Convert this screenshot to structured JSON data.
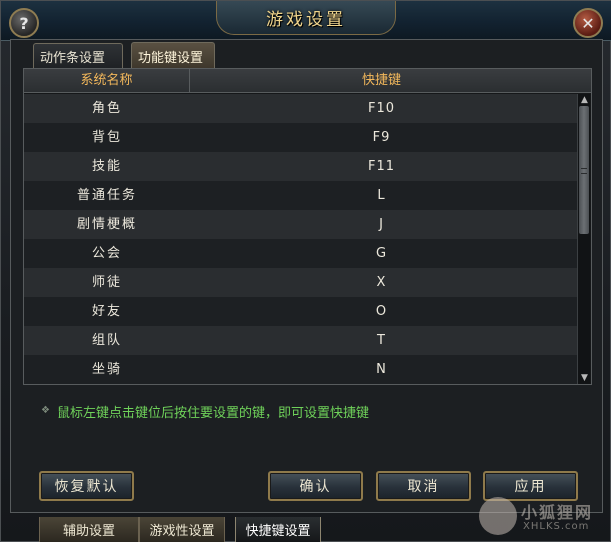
{
  "window": {
    "title": "游戏设置",
    "help_icon": "?",
    "close_icon": "✕"
  },
  "tabs": {
    "action_bar": "动作条设置",
    "hotkey": "功能键设置"
  },
  "table": {
    "headers": {
      "name": "系统名称",
      "key": "快捷键"
    },
    "rows": [
      {
        "name": "角色",
        "key": "F10"
      },
      {
        "name": "背包",
        "key": "F9"
      },
      {
        "name": "技能",
        "key": "F11"
      },
      {
        "name": "普通任务",
        "key": "L"
      },
      {
        "name": "剧情梗概",
        "key": "J"
      },
      {
        "name": "公会",
        "key": "G"
      },
      {
        "name": "师徒",
        "key": "X"
      },
      {
        "name": "好友",
        "key": "O"
      },
      {
        "name": "组队",
        "key": "T"
      },
      {
        "name": "坐骑",
        "key": "N"
      }
    ],
    "scroll_up_icon": "▲",
    "scroll_down_icon": "▼"
  },
  "hint": {
    "icon": "❖",
    "text": "鼠标左键点击键位后按住要设置的键，即可设置快捷键"
  },
  "buttons": {
    "restore": "恢复默认",
    "confirm": "确认",
    "cancel": "取消",
    "apply": "应用"
  },
  "bottom_tabs": {
    "assist": "辅助设置",
    "gameplay": "游戏性设置",
    "hotkey": "快捷键设置"
  },
  "watermark": {
    "text": "小狐狸网",
    "sub": "XHLKS.com"
  },
  "colors": {
    "header_text": "#f3b85b",
    "hint_text": "#6fd25a",
    "title_text": "#f0d58c",
    "button_border": "#8f7a4b"
  }
}
